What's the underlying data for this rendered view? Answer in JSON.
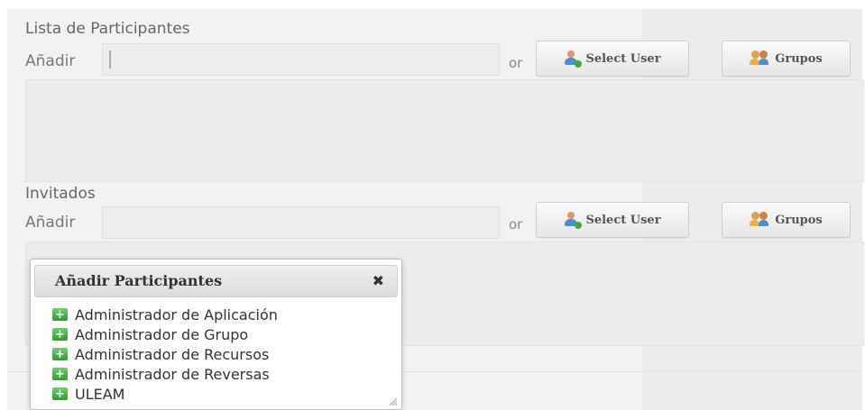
{
  "participants": {
    "title": "Lista de Participantes",
    "add_label": "Añadir",
    "input_value": "",
    "or_label": "or",
    "select_user_label": "Select User",
    "groups_label": "Grupos"
  },
  "guests": {
    "title": "Invitados",
    "add_label": "Añadir",
    "input_value": "",
    "or_label": "or",
    "select_user_label": "Select User",
    "groups_label": "Grupos"
  },
  "popup": {
    "title": "Añadir Participantes",
    "close_glyph": "✖",
    "items": [
      {
        "label": "Administrador de Aplicación"
      },
      {
        "label": "Administrador de Grupo"
      },
      {
        "label": "Administrador de Recursos"
      },
      {
        "label": "Administrador de Reversas"
      },
      {
        "label": "ULEAM"
      }
    ]
  },
  "icons": {
    "select_user": "add-user-icon",
    "groups": "group-icon",
    "popup_item": "add-green-icon",
    "close": "close-icon"
  },
  "colors": {
    "background": "#f2f2f2",
    "button_text": "#555555",
    "add_icon_green": "#3bab3b"
  }
}
